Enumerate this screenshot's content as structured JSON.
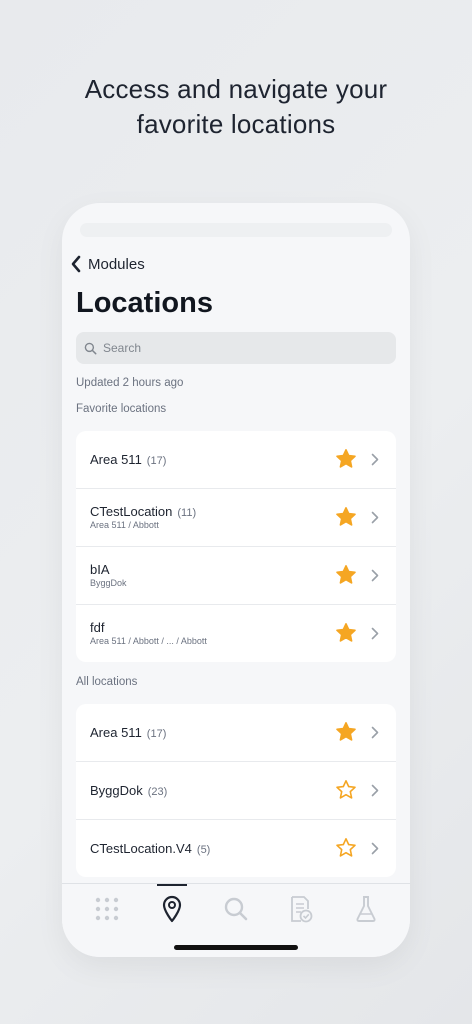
{
  "headline": {
    "line1": "Access and navigate your",
    "line2": "favorite locations"
  },
  "nav": {
    "back_label": "Modules"
  },
  "page": {
    "title": "Locations"
  },
  "search": {
    "placeholder": "Search"
  },
  "updated": "Updated 2 hours ago",
  "favorites": {
    "heading": "Favorite locations",
    "items": [
      {
        "name": "Area 511",
        "count": "(17)",
        "path": "",
        "starred": true
      },
      {
        "name": "CTestLocation",
        "count": "(11)",
        "path": "Area 511 / Abbott",
        "starred": true
      },
      {
        "name": "bIA",
        "count": "",
        "path": "ByggDok",
        "starred": true
      },
      {
        "name": "fdf",
        "count": "",
        "path": "Area 511 / Abbott / ... / Abbott",
        "starred": true
      }
    ]
  },
  "all": {
    "heading": "All locations",
    "items": [
      {
        "name": "Area 511",
        "count": "(17)",
        "path": "",
        "starred": true
      },
      {
        "name": "ByggDok",
        "count": "(23)",
        "path": "",
        "starred": false
      },
      {
        "name": "CTestLocation.V4",
        "count": "(5)",
        "path": "",
        "starred": false
      }
    ]
  },
  "tabbar": {
    "tabs": [
      {
        "icon": "grid-icon",
        "active": false
      },
      {
        "icon": "location-pin-icon",
        "active": true
      },
      {
        "icon": "search-icon",
        "active": false
      },
      {
        "icon": "checklist-document-icon",
        "active": false
      },
      {
        "icon": "flask-icon",
        "active": false
      }
    ]
  },
  "colors": {
    "star": "#f5a623",
    "text": "#1e2430",
    "muted": "#6b7280"
  }
}
